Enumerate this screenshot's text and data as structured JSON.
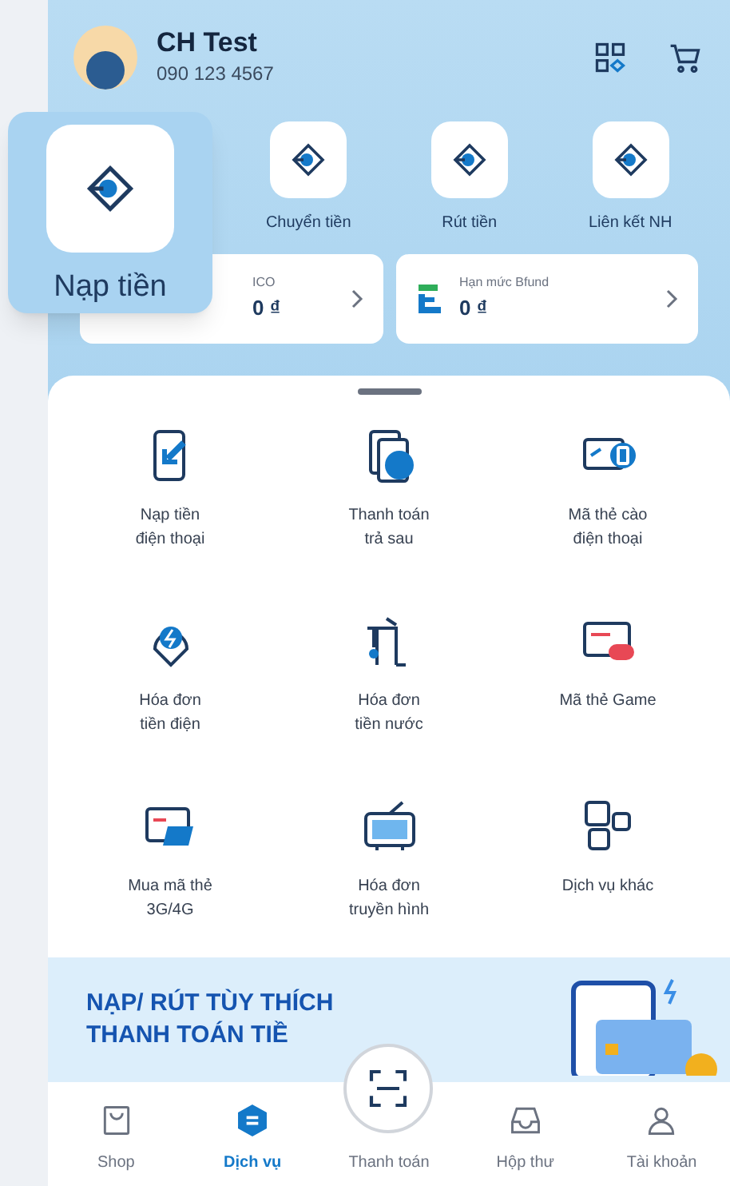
{
  "profile": {
    "name": "CH Test",
    "phone": "090 123 4567"
  },
  "quick_actions": [
    {
      "label": "Nạp tiền",
      "highlighted": true
    },
    {
      "label": "Chuyển tiền",
      "highlighted": false
    },
    {
      "label": "Rút tiền",
      "highlighted": false
    },
    {
      "label": "Liên kết NH",
      "highlighted": false
    }
  ],
  "balance_cards": [
    {
      "kind": "wallet",
      "label": "ICO",
      "value": "0 ₫"
    },
    {
      "kind": "credit",
      "label": "Hạn mức Bfund",
      "value": "0 ₫"
    }
  ],
  "services": [
    {
      "kind": "phone-topup",
      "label": "Nạp tiền\nđiện thoại"
    },
    {
      "kind": "postpaid",
      "label": "Thanh toán\ntrả sau"
    },
    {
      "kind": "scratch-card",
      "label": "Mã thẻ cào\nđiện thoại"
    },
    {
      "kind": "electric",
      "label": "Hóa đơn\ntiền điện"
    },
    {
      "kind": "water",
      "label": "Hóa đơn\ntiền nước"
    },
    {
      "kind": "game",
      "label": "Mã thẻ Game"
    },
    {
      "kind": "data",
      "label": "Mua mã thẻ\n3G/4G"
    },
    {
      "kind": "tv",
      "label": "Hóa đơn\ntruyền hình"
    },
    {
      "kind": "more",
      "label": "Dịch vụ khác"
    }
  ],
  "banner": {
    "line1": "NẠP/ RÚT TÙY THÍCH",
    "line2": "THANH TOÁN TIỀ"
  },
  "bottom_nav": [
    {
      "kind": "shop",
      "label": "Shop",
      "selected": false
    },
    {
      "kind": "services",
      "label": "Dịch vụ",
      "selected": true
    },
    {
      "kind": "scan",
      "label": "Thanh toán",
      "selected": false
    },
    {
      "kind": "inbox",
      "label": "Hộp thư",
      "selected": false
    },
    {
      "kind": "account",
      "label": "Tài khoản",
      "selected": false
    }
  ]
}
